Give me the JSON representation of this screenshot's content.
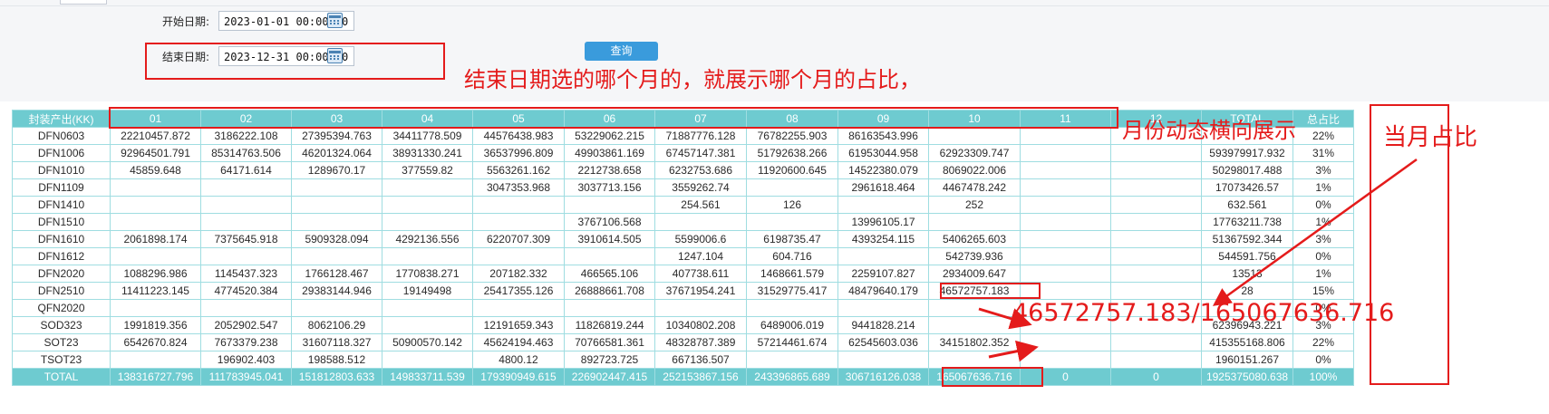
{
  "filters": {
    "start_label": "开始日期:",
    "start_value": "2023-01-01 00:00:00",
    "end_label": "结束日期:",
    "end_value": "2023-12-31 00:00:00",
    "query_label": "查询"
  },
  "annotations": {
    "end_date_note": "结束日期选的哪个月的，就展示哪个月的占比，",
    "month_note": "月份动态横向展示",
    "ratio_note": "当月占比",
    "calc_note": "46572757.183/165067636.716"
  },
  "colors": {
    "header": "#6ecbd0",
    "grid_border": "#9fdde1",
    "annotation": "#e41b1b",
    "button": "#3a9bdc"
  },
  "table": {
    "columns": [
      "封装产出(KK)",
      "01",
      "02",
      "03",
      "04",
      "05",
      "06",
      "07",
      "08",
      "09",
      "10",
      "11",
      "12",
      "TOTAL",
      "总占比"
    ],
    "rows": [
      [
        "DFN0603",
        "22210457.872",
        "3186222.108",
        "27395394.763",
        "34411778.509",
        "44576438.983",
        "53229062.215",
        "71887776.128",
        "76782255.903",
        "86163543.996",
        "",
        "",
        "",
        "",
        "22%"
      ],
      [
        "DFN1006",
        "92964501.791",
        "85314763.506",
        "46201324.064",
        "38931330.241",
        "36537996.809",
        "49903861.169",
        "67457147.381",
        "51792638.266",
        "61953044.958",
        "62923309.747",
        "",
        "",
        "593979917.932",
        "31%"
      ],
      [
        "DFN1010",
        "45859.648",
        "64171.614",
        "1289670.17",
        "377559.82",
        "5563261.162",
        "2212738.658",
        "6232753.686",
        "11920600.645",
        "14522380.079",
        "8069022.006",
        "",
        "",
        "50298017.488",
        "3%"
      ],
      [
        "DFN1109",
        "",
        "",
        "",
        "",
        "3047353.968",
        "3037713.156",
        "3559262.74",
        "",
        "2961618.464",
        "4467478.242",
        "",
        "",
        "17073426.57",
        "1%"
      ],
      [
        "DFN1410",
        "",
        "",
        "",
        "",
        "",
        "",
        "254.561",
        "126",
        "",
        "252",
        "",
        "",
        "632.561",
        "0%"
      ],
      [
        "DFN1510",
        "",
        "",
        "",
        "",
        "",
        "3767106.568",
        "",
        "",
        "13996105.17",
        "",
        "",
        "",
        "17763211.738",
        "1%"
      ],
      [
        "DFN1610",
        "2061898.174",
        "7375645.918",
        "5909328.094",
        "4292136.556",
        "6220707.309",
        "3910614.505",
        "5599006.6",
        "6198735.47",
        "4393254.115",
        "5406265.603",
        "",
        "",
        "51367592.344",
        "3%"
      ],
      [
        "DFN1612",
        "",
        "",
        "",
        "",
        "",
        "",
        "1247.104",
        "604.716",
        "",
        "542739.936",
        "",
        "",
        "544591.756",
        "0%"
      ],
      [
        "DFN2020",
        "1088296.986",
        "1145437.323",
        "1766128.467",
        "1770838.271",
        "207182.332",
        "466565.106",
        "407738.611",
        "1468661.579",
        "2259107.827",
        "2934009.647",
        "",
        "",
        "13513",
        "1%"
      ],
      [
        "DFN2510",
        "11411223.145",
        "4774520.384",
        "29383144.946",
        "19149498",
        "25417355.126",
        "26888661.708",
        "37671954.241",
        "31529775.417",
        "48479640.179",
        "46572757.183",
        "",
        "",
        "28",
        "15%"
      ],
      [
        "QFN2020",
        "",
        "",
        "",
        "",
        "",
        "",
        "",
        "",
        "",
        "",
        "",
        "",
        "",
        "0%"
      ],
      [
        "SOD323",
        "1991819.356",
        "2052902.547",
        "8062106.29",
        "",
        "12191659.343",
        "11826819.244",
        "10340802.208",
        "6489006.019",
        "9441828.214",
        "",
        "",
        "",
        "62396943.221",
        "3%"
      ],
      [
        "SOT23",
        "6542670.824",
        "7673379.238",
        "31607118.327",
        "50900570.142",
        "45624194.463",
        "70766581.361",
        "48328787.389",
        "57214461.674",
        "62545603.036",
        "34151802.352",
        "",
        "",
        "415355168.806",
        "22%"
      ],
      [
        "TSOT23",
        "",
        "196902.403",
        "198588.512",
        "",
        "4800.12",
        "892723.725",
        "667136.507",
        "",
        "",
        "",
        "",
        "",
        "1960151.267",
        "0%"
      ]
    ],
    "total_row": [
      "TOTAL",
      "138316727.796",
      "111783945.041",
      "151812803.633",
      "149833711.539",
      "179390949.615",
      "226902447.415",
      "252153867.156",
      "243396865.689",
      "306716126.038",
      "165067636.716",
      "0",
      "0",
      "1925375080.638",
      "100%"
    ]
  }
}
